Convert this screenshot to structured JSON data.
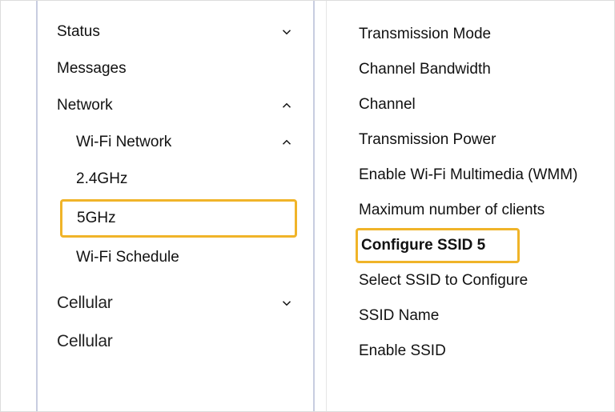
{
  "sidebar": {
    "status_label": "Status",
    "messages_label": "Messages",
    "network_label": "Network",
    "wifi_network_label": "Wi-Fi Network",
    "band_24_label": "2.4GHz",
    "band_5_label": "5GHz",
    "wifi_schedule_label": "Wi-Fi Schedule",
    "cellular_label_1": "Cellular",
    "cellular_label_2": "Cellular"
  },
  "settings": {
    "transmission_mode": "Transmission Mode",
    "channel_bandwidth": "Channel Bandwidth",
    "channel": "Channel",
    "transmission_power": "Transmission Power",
    "enable_wmm": "Enable Wi-Fi Multimedia (WMM)",
    "max_clients": "Maximum number of clients",
    "configure_ssid": "Configure SSID 5",
    "select_ssid": "Select SSID to Configure",
    "ssid_name": "SSID Name",
    "enable_ssid": "Enable SSID"
  }
}
